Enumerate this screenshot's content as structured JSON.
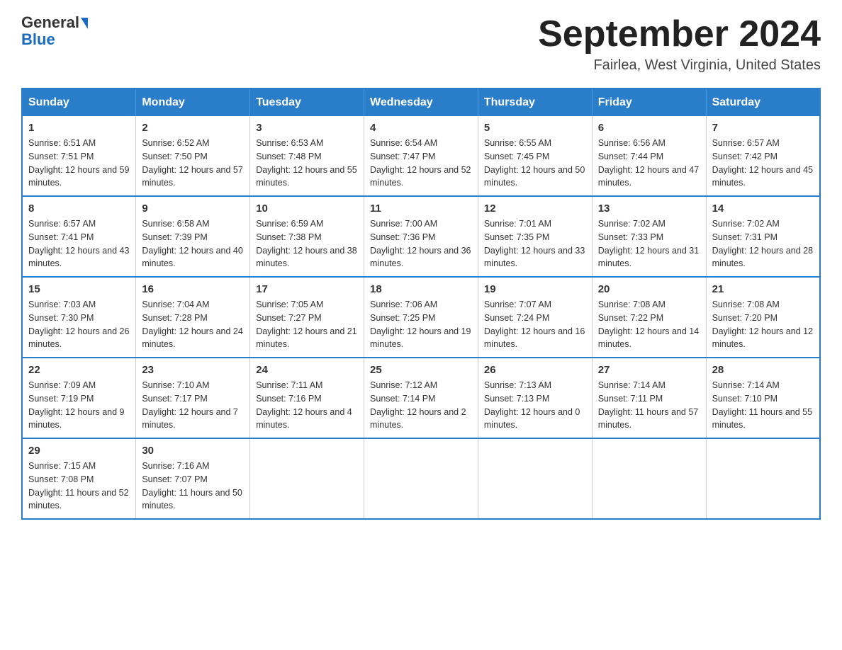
{
  "header": {
    "logo_general": "General",
    "logo_blue": "Blue",
    "month_title": "September 2024",
    "subtitle": "Fairlea, West Virginia, United States"
  },
  "days_of_week": [
    "Sunday",
    "Monday",
    "Tuesday",
    "Wednesday",
    "Thursday",
    "Friday",
    "Saturday"
  ],
  "weeks": [
    [
      {
        "day": "1",
        "sunrise": "6:51 AM",
        "sunset": "7:51 PM",
        "daylight": "12 hours and 59 minutes."
      },
      {
        "day": "2",
        "sunrise": "6:52 AM",
        "sunset": "7:50 PM",
        "daylight": "12 hours and 57 minutes."
      },
      {
        "day": "3",
        "sunrise": "6:53 AM",
        "sunset": "7:48 PM",
        "daylight": "12 hours and 55 minutes."
      },
      {
        "day": "4",
        "sunrise": "6:54 AM",
        "sunset": "7:47 PM",
        "daylight": "12 hours and 52 minutes."
      },
      {
        "day": "5",
        "sunrise": "6:55 AM",
        "sunset": "7:45 PM",
        "daylight": "12 hours and 50 minutes."
      },
      {
        "day": "6",
        "sunrise": "6:56 AM",
        "sunset": "7:44 PM",
        "daylight": "12 hours and 47 minutes."
      },
      {
        "day": "7",
        "sunrise": "6:57 AM",
        "sunset": "7:42 PM",
        "daylight": "12 hours and 45 minutes."
      }
    ],
    [
      {
        "day": "8",
        "sunrise": "6:57 AM",
        "sunset": "7:41 PM",
        "daylight": "12 hours and 43 minutes."
      },
      {
        "day": "9",
        "sunrise": "6:58 AM",
        "sunset": "7:39 PM",
        "daylight": "12 hours and 40 minutes."
      },
      {
        "day": "10",
        "sunrise": "6:59 AM",
        "sunset": "7:38 PM",
        "daylight": "12 hours and 38 minutes."
      },
      {
        "day": "11",
        "sunrise": "7:00 AM",
        "sunset": "7:36 PM",
        "daylight": "12 hours and 36 minutes."
      },
      {
        "day": "12",
        "sunrise": "7:01 AM",
        "sunset": "7:35 PM",
        "daylight": "12 hours and 33 minutes."
      },
      {
        "day": "13",
        "sunrise": "7:02 AM",
        "sunset": "7:33 PM",
        "daylight": "12 hours and 31 minutes."
      },
      {
        "day": "14",
        "sunrise": "7:02 AM",
        "sunset": "7:31 PM",
        "daylight": "12 hours and 28 minutes."
      }
    ],
    [
      {
        "day": "15",
        "sunrise": "7:03 AM",
        "sunset": "7:30 PM",
        "daylight": "12 hours and 26 minutes."
      },
      {
        "day": "16",
        "sunrise": "7:04 AM",
        "sunset": "7:28 PM",
        "daylight": "12 hours and 24 minutes."
      },
      {
        "day": "17",
        "sunrise": "7:05 AM",
        "sunset": "7:27 PM",
        "daylight": "12 hours and 21 minutes."
      },
      {
        "day": "18",
        "sunrise": "7:06 AM",
        "sunset": "7:25 PM",
        "daylight": "12 hours and 19 minutes."
      },
      {
        "day": "19",
        "sunrise": "7:07 AM",
        "sunset": "7:24 PM",
        "daylight": "12 hours and 16 minutes."
      },
      {
        "day": "20",
        "sunrise": "7:08 AM",
        "sunset": "7:22 PM",
        "daylight": "12 hours and 14 minutes."
      },
      {
        "day": "21",
        "sunrise": "7:08 AM",
        "sunset": "7:20 PM",
        "daylight": "12 hours and 12 minutes."
      }
    ],
    [
      {
        "day": "22",
        "sunrise": "7:09 AM",
        "sunset": "7:19 PM",
        "daylight": "12 hours and 9 minutes."
      },
      {
        "day": "23",
        "sunrise": "7:10 AM",
        "sunset": "7:17 PM",
        "daylight": "12 hours and 7 minutes."
      },
      {
        "day": "24",
        "sunrise": "7:11 AM",
        "sunset": "7:16 PM",
        "daylight": "12 hours and 4 minutes."
      },
      {
        "day": "25",
        "sunrise": "7:12 AM",
        "sunset": "7:14 PM",
        "daylight": "12 hours and 2 minutes."
      },
      {
        "day": "26",
        "sunrise": "7:13 AM",
        "sunset": "7:13 PM",
        "daylight": "12 hours and 0 minutes."
      },
      {
        "day": "27",
        "sunrise": "7:14 AM",
        "sunset": "7:11 PM",
        "daylight": "11 hours and 57 minutes."
      },
      {
        "day": "28",
        "sunrise": "7:14 AM",
        "sunset": "7:10 PM",
        "daylight": "11 hours and 55 minutes."
      }
    ],
    [
      {
        "day": "29",
        "sunrise": "7:15 AM",
        "sunset": "7:08 PM",
        "daylight": "11 hours and 52 minutes."
      },
      {
        "day": "30",
        "sunrise": "7:16 AM",
        "sunset": "7:07 PM",
        "daylight": "11 hours and 50 minutes."
      },
      null,
      null,
      null,
      null,
      null
    ]
  ],
  "labels": {
    "sunrise": "Sunrise:",
    "sunset": "Sunset:",
    "daylight": "Daylight:"
  }
}
